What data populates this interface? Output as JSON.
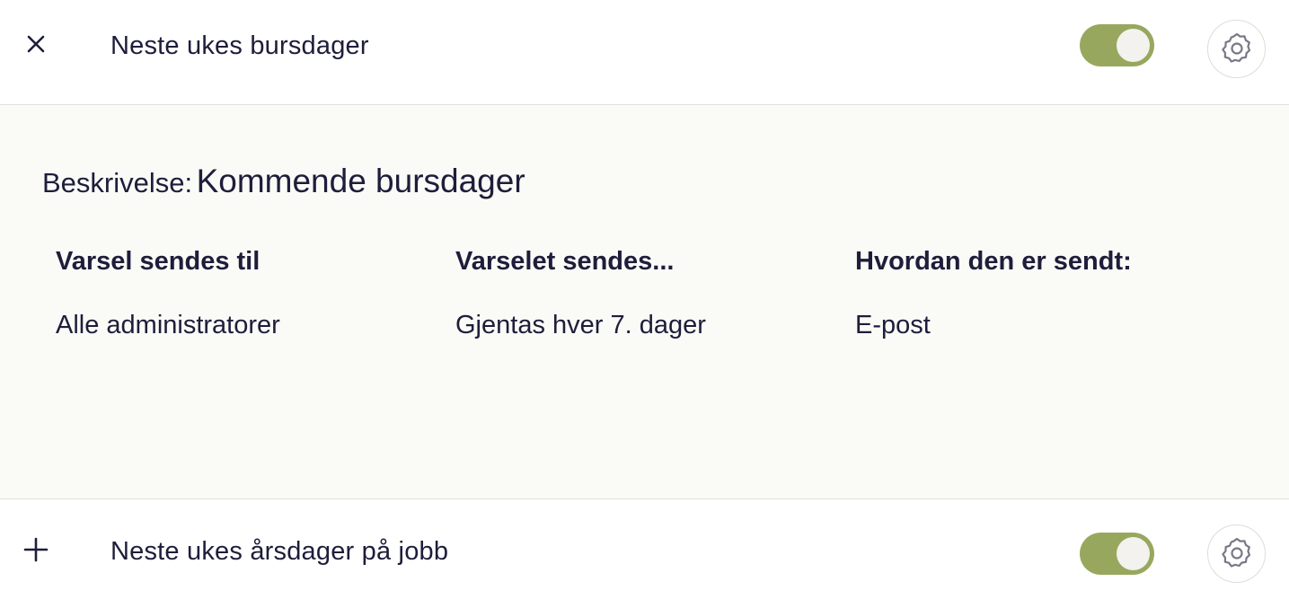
{
  "notifications": [
    {
      "expand_icon": "close-icon",
      "title": "Neste ukes bursdager",
      "enabled": true,
      "settings_icon": "gear-icon"
    },
    {
      "expand_icon": "plus-icon",
      "title": "Neste ukes årsdager på jobb",
      "enabled": true,
      "settings_icon": "gear-icon"
    }
  ],
  "details": {
    "description_label": "Beskrivelse:",
    "description_value": "Kommende bursdager",
    "columns": [
      {
        "header": "Varsel sendes til",
        "value": "Alle administratorer"
      },
      {
        "header": "Varselet sendes...",
        "value": "Gjentas hver 7. dager"
      },
      {
        "header": "Hvordan den er sendt:",
        "value": "E-post"
      }
    ]
  },
  "colors": {
    "toggle_on": "#97a85e",
    "text": "#1e1d3a",
    "panel_bg": "#fafaf7"
  }
}
